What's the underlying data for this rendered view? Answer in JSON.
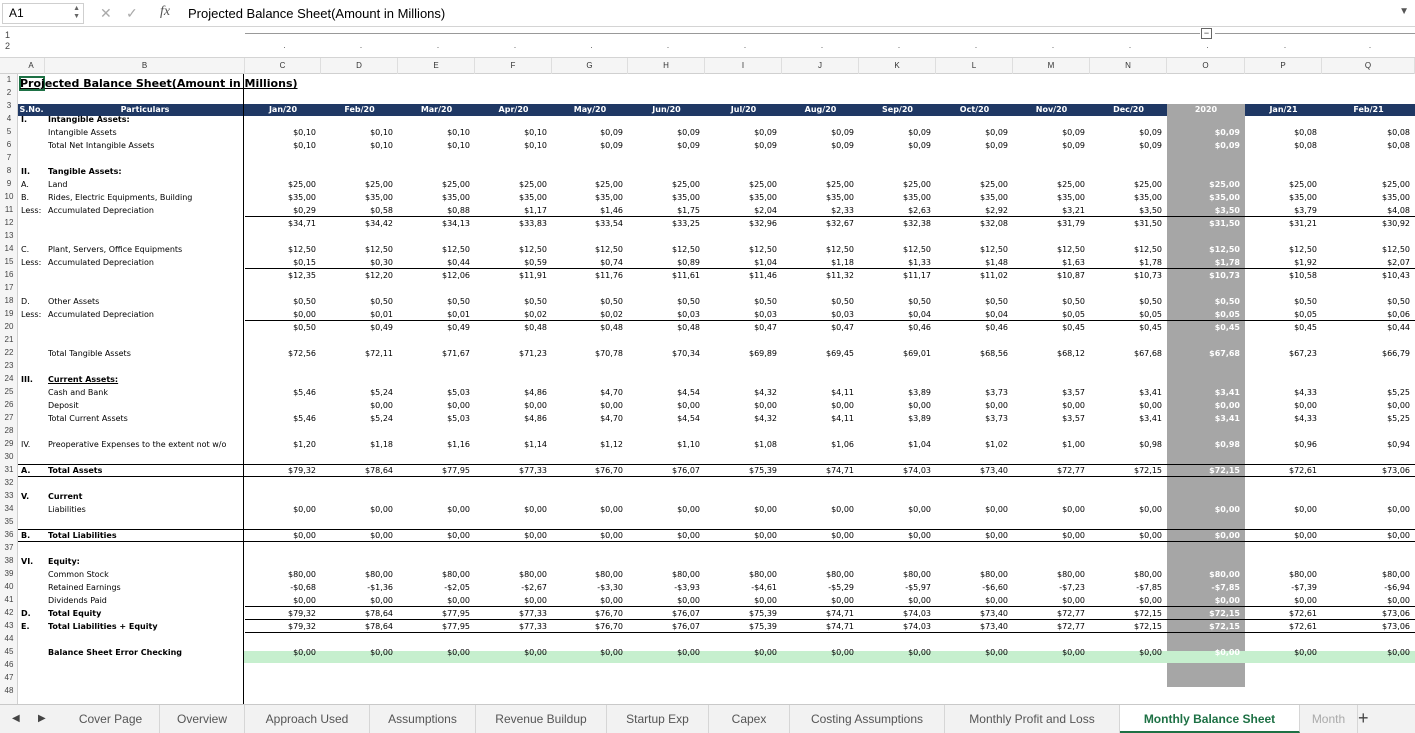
{
  "formula_bar": {
    "cell_ref": "A1",
    "formula": "Projected Balance Sheet(Amount in Millions)"
  },
  "column_letters": [
    "A",
    "B",
    "C",
    "D",
    "E",
    "F",
    "G",
    "H",
    "I",
    "J",
    "K",
    "L",
    "M",
    "N",
    "O",
    "P",
    "Q"
  ],
  "row_numbers": [
    "1",
    "2",
    "3",
    "4",
    "5",
    "6",
    "7",
    "8",
    "9",
    "10",
    "11",
    "12",
    "13",
    "14",
    "15",
    "16",
    "17",
    "18",
    "19",
    "20",
    "21",
    "22",
    "23",
    "24",
    "25",
    "26",
    "27",
    "28",
    "29",
    "30",
    "31",
    "32",
    "33",
    "34",
    "35",
    "36",
    "37",
    "38",
    "39",
    "40",
    "41",
    "42",
    "43",
    "44",
    "45",
    "46",
    "47",
    "48"
  ],
  "group_levels": [
    "1",
    "2"
  ],
  "sheet_title": "Projected Balance Sheet(Amount in Millions)",
  "header": {
    "sno": "S.No.",
    "particulars": "Particulars",
    "months": [
      "Jan/20",
      "Feb/20",
      "Mar/20",
      "Apr/20",
      "May/20",
      "Jun/20",
      "Jul/20",
      "Aug/20",
      "Sep/20",
      "Oct/20",
      "Nov/20",
      "Dec/20",
      "2020",
      "Jan/21",
      "Feb/21"
    ]
  },
  "rows": [
    {
      "r": 4,
      "a": "I.",
      "b": "Intangible Assets:",
      "bold": true
    },
    {
      "r": 5,
      "b": "Intangible Assets",
      "v": [
        "$0,10",
        "$0,10",
        "$0,10",
        "$0,10",
        "$0,09",
        "$0,09",
        "$0,09",
        "$0,09",
        "$0,09",
        "$0,09",
        "$0,09",
        "$0,09",
        "$0,09",
        "$0,08",
        "$0,08"
      ]
    },
    {
      "r": 6,
      "b": "Total Net Intangible Assets",
      "v": [
        "$0,10",
        "$0,10",
        "$0,10",
        "$0,10",
        "$0,09",
        "$0,09",
        "$0,09",
        "$0,09",
        "$0,09",
        "$0,09",
        "$0,09",
        "$0,09",
        "$0,09",
        "$0,08",
        "$0,08"
      ]
    },
    {
      "r": 8,
      "a": "II.",
      "b": "Tangible Assets:",
      "bold": true
    },
    {
      "r": 9,
      "a": "A.",
      "b": "Land",
      "v": [
        "$25,00",
        "$25,00",
        "$25,00",
        "$25,00",
        "$25,00",
        "$25,00",
        "$25,00",
        "$25,00",
        "$25,00",
        "$25,00",
        "$25,00",
        "$25,00",
        "$25,00",
        "$25,00",
        "$25,00"
      ]
    },
    {
      "r": 10,
      "a": "B.",
      "b": "Rides, Electric Equipments, Building",
      "v": [
        "$35,00",
        "$35,00",
        "$35,00",
        "$35,00",
        "$35,00",
        "$35,00",
        "$35,00",
        "$35,00",
        "$35,00",
        "$35,00",
        "$35,00",
        "$35,00",
        "$35,00",
        "$35,00",
        "$35,00"
      ]
    },
    {
      "r": 11,
      "a": "Less:",
      "b": "Accumulated Depreciation",
      "v": [
        "$0,29",
        "$0,58",
        "$0,88",
        "$1,17",
        "$1,46",
        "$1,75",
        "$2,04",
        "$2,33",
        "$2,63",
        "$2,92",
        "$3,21",
        "$3,50",
        "$3,50",
        "$3,79",
        "$4,08"
      ],
      "line": true
    },
    {
      "r": 12,
      "v": [
        "$34,71",
        "$34,42",
        "$34,13",
        "$33,83",
        "$33,54",
        "$33,25",
        "$32,96",
        "$32,67",
        "$32,38",
        "$32,08",
        "$31,79",
        "$31,50",
        "$31,50",
        "$31,21",
        "$30,92"
      ]
    },
    {
      "r": 14,
      "a": "C.",
      "b": "Plant, Servers, Office Equipments",
      "v": [
        "$12,50",
        "$12,50",
        "$12,50",
        "$12,50",
        "$12,50",
        "$12,50",
        "$12,50",
        "$12,50",
        "$12,50",
        "$12,50",
        "$12,50",
        "$12,50",
        "$12,50",
        "$12,50",
        "$12,50"
      ]
    },
    {
      "r": 15,
      "a": "Less:",
      "b": "Accumulated Depreciation",
      "v": [
        "$0,15",
        "$0,30",
        "$0,44",
        "$0,59",
        "$0,74",
        "$0,89",
        "$1,04",
        "$1,18",
        "$1,33",
        "$1,48",
        "$1,63",
        "$1,78",
        "$1,78",
        "$1,92",
        "$2,07"
      ],
      "line": true
    },
    {
      "r": 16,
      "v": [
        "$12,35",
        "$12,20",
        "$12,06",
        "$11,91",
        "$11,76",
        "$11,61",
        "$11,46",
        "$11,32",
        "$11,17",
        "$11,02",
        "$10,87",
        "$10,73",
        "$10,73",
        "$10,58",
        "$10,43"
      ]
    },
    {
      "r": 18,
      "a": "D.",
      "b": "Other Assets",
      "v": [
        "$0,50",
        "$0,50",
        "$0,50",
        "$0,50",
        "$0,50",
        "$0,50",
        "$0,50",
        "$0,50",
        "$0,50",
        "$0,50",
        "$0,50",
        "$0,50",
        "$0,50",
        "$0,50",
        "$0,50"
      ]
    },
    {
      "r": 19,
      "a": "Less:",
      "b": "Accumulated Depreciation",
      "v": [
        "$0,00",
        "$0,01",
        "$0,01",
        "$0,02",
        "$0,02",
        "$0,03",
        "$0,03",
        "$0,03",
        "$0,04",
        "$0,04",
        "$0,05",
        "$0,05",
        "$0,05",
        "$0,05",
        "$0,06"
      ],
      "line": true
    },
    {
      "r": 20,
      "v": [
        "$0,50",
        "$0,49",
        "$0,49",
        "$0,48",
        "$0,48",
        "$0,48",
        "$0,47",
        "$0,47",
        "$0,46",
        "$0,46",
        "$0,45",
        "$0,45",
        "$0,45",
        "$0,45",
        "$0,44"
      ]
    },
    {
      "r": 22,
      "b": "Total Tangible Assets",
      "v": [
        "$72,56",
        "$72,11",
        "$71,67",
        "$71,23",
        "$70,78",
        "$70,34",
        "$69,89",
        "$69,45",
        "$69,01",
        "$68,56",
        "$68,12",
        "$67,68",
        "$67,68",
        "$67,23",
        "$66,79"
      ]
    },
    {
      "r": 24,
      "a": "III.",
      "b": "Current Assets:",
      "bold": true,
      "underline": true
    },
    {
      "r": 25,
      "b": "Cash and Bank",
      "v": [
        "$5,46",
        "$5,24",
        "$5,03",
        "$4,86",
        "$4,70",
        "$4,54",
        "$4,32",
        "$4,11",
        "$3,89",
        "$3,73",
        "$3,57",
        "$3,41",
        "$3,41",
        "$4,33",
        "$5,25"
      ]
    },
    {
      "r": 26,
      "b": "Deposit",
      "v": [
        "",
        "$0,00",
        "$0,00",
        "$0,00",
        "$0,00",
        "$0,00",
        "$0,00",
        "$0,00",
        "$0,00",
        "$0,00",
        "$0,00",
        "$0,00",
        "$0,00",
        "$0,00",
        "$0,00"
      ]
    },
    {
      "r": 27,
      "b": "Total Current Assets",
      "v": [
        "$5,46",
        "$5,24",
        "$5,03",
        "$4,86",
        "$4,70",
        "$4,54",
        "$4,32",
        "$4,11",
        "$3,89",
        "$3,73",
        "$3,57",
        "$3,41",
        "$3,41",
        "$4,33",
        "$5,25"
      ]
    },
    {
      "r": 29,
      "a": "IV.",
      "b": "Preoperative Expenses to the extent not w/o",
      "v": [
        "$1,20",
        "$1,18",
        "$1,16",
        "$1,14",
        "$1,12",
        "$1,10",
        "$1,08",
        "$1,06",
        "$1,04",
        "$1,02",
        "$1,00",
        "$0,98",
        "$0,98",
        "$0,96",
        "$0,94"
      ]
    },
    {
      "r": 31,
      "a": "A.",
      "b": "Total Assets",
      "bold": true,
      "boxed": true,
      "v": [
        "$79,32",
        "$78,64",
        "$77,95",
        "$77,33",
        "$76,70",
        "$76,07",
        "$75,39",
        "$74,71",
        "$74,03",
        "$73,40",
        "$72,77",
        "$72,15",
        "$72,15",
        "$72,61",
        "$73,06"
      ]
    },
    {
      "r": 33,
      "a": "V.",
      "b": "Current",
      "bold": true
    },
    {
      "r": 34,
      "b": "Liabilities",
      "v": [
        "$0,00",
        "$0,00",
        "$0,00",
        "$0,00",
        "$0,00",
        "$0,00",
        "$0,00",
        "$0,00",
        "$0,00",
        "$0,00",
        "$0,00",
        "$0,00",
        "$0,00",
        "$0,00",
        "$0,00"
      ]
    },
    {
      "r": 36,
      "a": "B.",
      "b": "Total Liabilities",
      "bold": true,
      "boxed": true,
      "v": [
        "$0,00",
        "$0,00",
        "$0,00",
        "$0,00",
        "$0,00",
        "$0,00",
        "$0,00",
        "$0,00",
        "$0,00",
        "$0,00",
        "$0,00",
        "$0,00",
        "$0,00",
        "$0,00",
        "$0,00"
      ]
    },
    {
      "r": 38,
      "a": "VI.",
      "b": "Equity:",
      "bold": true
    },
    {
      "r": 39,
      "b": "Common Stock",
      "v": [
        "$80,00",
        "$80,00",
        "$80,00",
        "$80,00",
        "$80,00",
        "$80,00",
        "$80,00",
        "$80,00",
        "$80,00",
        "$80,00",
        "$80,00",
        "$80,00",
        "$80,00",
        "$80,00",
        "$80,00"
      ]
    },
    {
      "r": 40,
      "b": "Retained Earnings",
      "v": [
        "-$0,68",
        "-$1,36",
        "-$2,05",
        "-$2,67",
        "-$3,30",
        "-$3,93",
        "-$4,61",
        "-$5,29",
        "-$5,97",
        "-$6,60",
        "-$7,23",
        "-$7,85",
        "-$7,85",
        "-$7,39",
        "-$6,94"
      ]
    },
    {
      "r": 41,
      "b": "Dividends Paid",
      "v": [
        "$0,00",
        "$0,00",
        "$0,00",
        "$0,00",
        "$0,00",
        "$0,00",
        "$0,00",
        "$0,00",
        "$0,00",
        "$0,00",
        "$0,00",
        "$0,00",
        "$0,00",
        "$0,00",
        "$0,00"
      ],
      "line": true
    },
    {
      "r": 42,
      "a": "D.",
      "b": "Total Equity",
      "bold": true,
      "v": [
        "$79,32",
        "$78,64",
        "$77,95",
        "$77,33",
        "$76,70",
        "$76,07",
        "$75,39",
        "$74,71",
        "$74,03",
        "$73,40",
        "$72,77",
        "$72,15",
        "$72,15",
        "$72,61",
        "$73,06"
      ],
      "line": true
    },
    {
      "r": 43,
      "a": "E.",
      "b": "Total Liabilities + Equity",
      "bold": true,
      "v": [
        "$79,32",
        "$78,64",
        "$77,95",
        "$77,33",
        "$76,70",
        "$76,07",
        "$75,39",
        "$74,71",
        "$74,03",
        "$73,40",
        "$72,77",
        "$72,15",
        "$72,15",
        "$72,61",
        "$73,06"
      ],
      "line": true
    },
    {
      "r": 45,
      "b": "Balance Sheet Error Checking",
      "bold": true,
      "v": [
        "$0,00",
        "$0,00",
        "$0,00",
        "$0,00",
        "$0,00",
        "$0,00",
        "$0,00",
        "$0,00",
        "$0,00",
        "$0,00",
        "$0,00",
        "$0,00",
        "$0,00",
        "$0,00",
        "$0,00"
      ]
    }
  ],
  "sheet_tabs": [
    {
      "label": "Cover Page",
      "active": false
    },
    {
      "label": "Overview",
      "active": false
    },
    {
      "label": "Approach Used",
      "active": false
    },
    {
      "label": "Assumptions",
      "active": false
    },
    {
      "label": "Revenue Buildup",
      "active": false
    },
    {
      "label": "Startup Exp",
      "active": false
    },
    {
      "label": "Capex",
      "active": false
    },
    {
      "label": "Costing Assumptions",
      "active": false
    },
    {
      "label": "Monthly Profit and Loss",
      "active": false
    },
    {
      "label": "Monthly Balance Sheet",
      "active": true
    },
    {
      "label": "Month",
      "active": false
    }
  ],
  "colors": {
    "header_bg": "#1f3864",
    "highlight_col": "#a6a6a6",
    "error_row": "#c6efce",
    "active_tab": "#1e7145"
  }
}
